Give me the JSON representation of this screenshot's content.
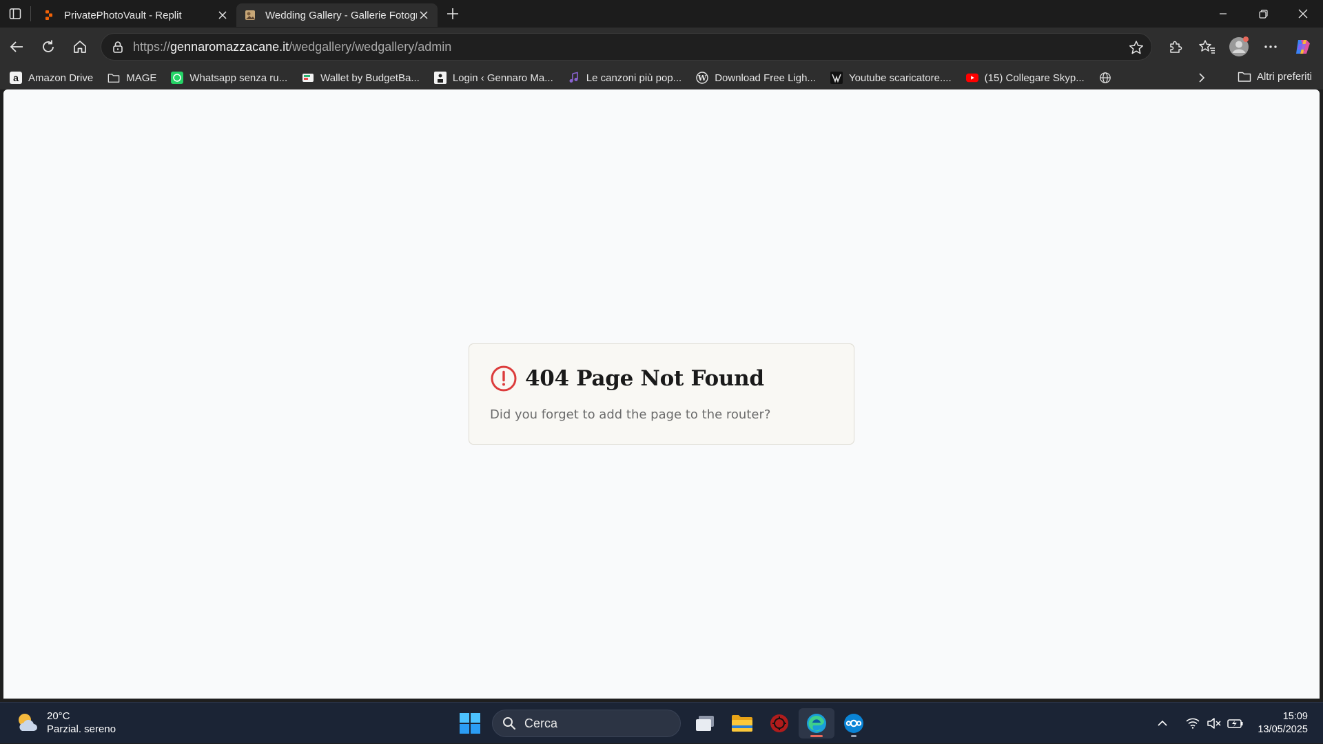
{
  "browser": {
    "tabs": [
      {
        "title": "PrivatePhotoVault - Replit",
        "favicon": "replit-icon",
        "active": false
      },
      {
        "title": "Wedding Gallery - Gallerie Fotografiche",
        "favicon": "gallery-icon",
        "active": true
      }
    ],
    "address": {
      "scheme": "https://",
      "host": "gennaromazzacane.it",
      "path": "/wedgallery/wedgallery/admin"
    },
    "bookmarks": [
      {
        "label": "Amazon Drive",
        "icon": "amazon-icon"
      },
      {
        "label": "MAGE",
        "icon": "folder-icon"
      },
      {
        "label": "Whatsapp senza ru...",
        "icon": "whatsapp-icon"
      },
      {
        "label": "Wallet by BudgetBa...",
        "icon": "wallet-icon"
      },
      {
        "label": "Login ‹ Gennaro Ma...",
        "icon": "login-icon"
      },
      {
        "label": "Le canzoni più pop...",
        "icon": "music-icon"
      },
      {
        "label": "Download Free Ligh...",
        "icon": "wordpress-icon"
      },
      {
        "label": "Youtube scaricatore....",
        "icon": "downloader-icon"
      },
      {
        "label": "(15) Collegare Skyp...",
        "icon": "youtube-icon"
      },
      {
        "label": "",
        "icon": "globe-icon"
      }
    ],
    "other_bookmarks": "Altri preferiti"
  },
  "page": {
    "error_title": "404 Page Not Found",
    "error_message": "Did you forget to add the page to the router?",
    "alert_color": "#dc3c3c"
  },
  "taskbar": {
    "weather_temp": "20°C",
    "weather_condition": "Parzial. sereno",
    "search_label": "Cerca",
    "time": "15:09",
    "date": "13/05/2025"
  }
}
